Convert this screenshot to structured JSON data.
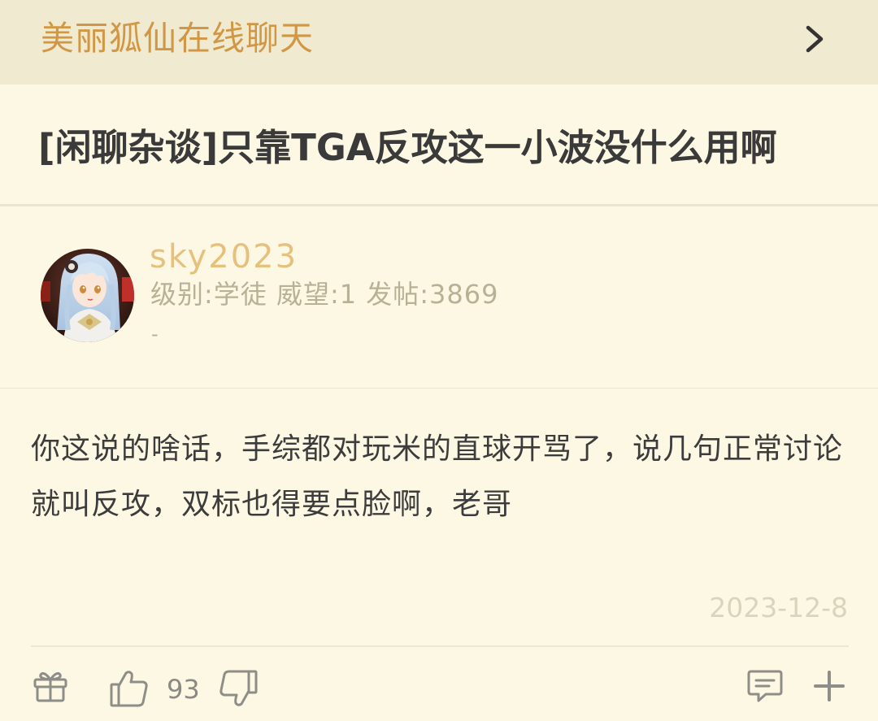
{
  "header": {
    "forum_name": "美丽狐仙在线聊天",
    "chevron_icon": "chevron-right-icon"
  },
  "thread": {
    "title": "[闲聊杂谈]只靠TGA反攻这一小波没什么用啊"
  },
  "author": {
    "username": "sky2023",
    "stats": "级别:学徒 威望:1 发帖:3869",
    "signature": "-"
  },
  "post": {
    "content": "你这说的啥话，手综都对玩米的直球开骂了，说几句正常讨论就叫反攻，双标也得要点脸啊，老哥",
    "date": "2023-12-8"
  },
  "actions": {
    "gift_icon": "gift-icon",
    "like_icon": "thumbs-up-icon",
    "like_count": "93",
    "dislike_icon": "thumbs-down-icon",
    "comment_icon": "comment-icon",
    "add_icon": "plus-icon"
  },
  "colors": {
    "background": "#fdf8e4",
    "header_bg": "#efead0",
    "accent": "#d29745",
    "username": "#e6c07d"
  }
}
